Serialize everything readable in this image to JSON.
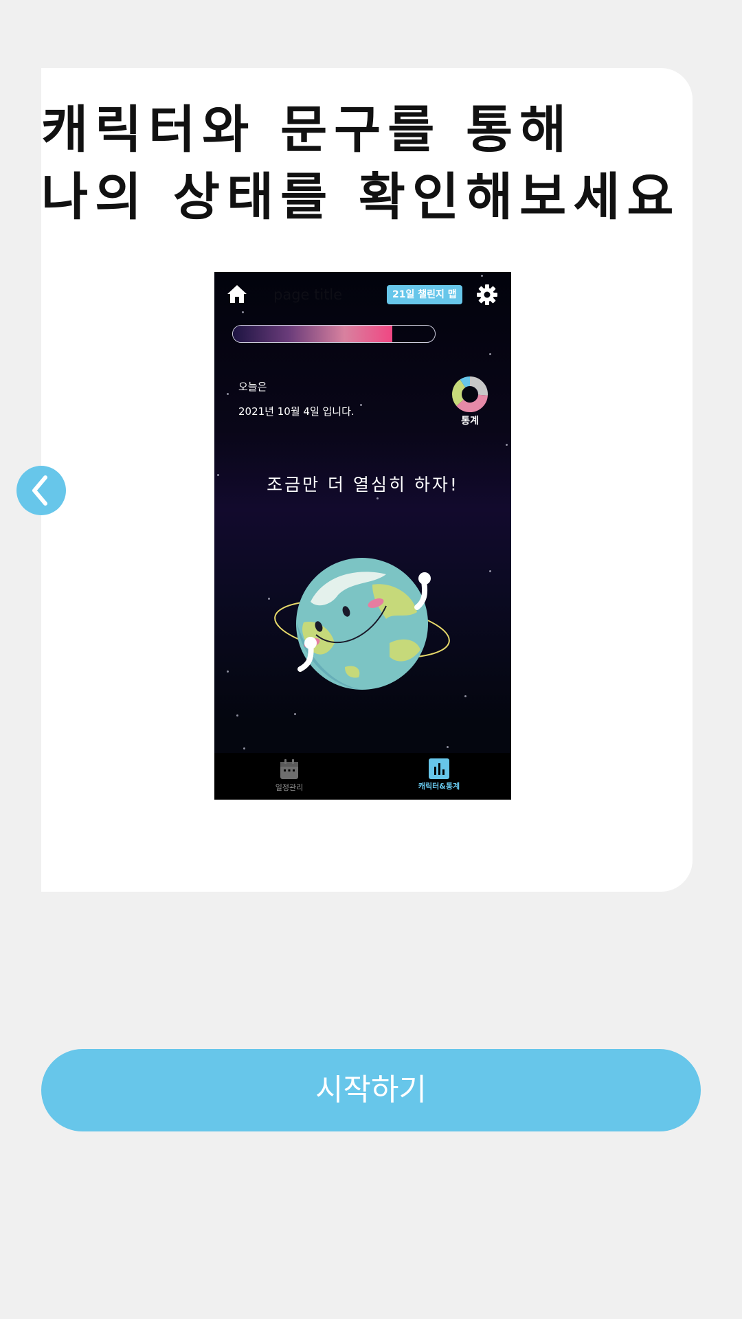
{
  "headline": {
    "line1": "캐릭터와 문구를 통해",
    "line2": "나의 상태를 확인해보세요"
  },
  "back_icon": "chevron-left-icon",
  "preview": {
    "header": {
      "page_title": "page title",
      "challenge_badge": "21일 챌린지 맵",
      "home_icon": "home-icon",
      "settings_icon": "gear-icon"
    },
    "progress": {
      "value": 0.79,
      "fill_color": "#f04783"
    },
    "today_label": "오늘은",
    "today_date": "2021년 10월 4일 입니다.",
    "stats": {
      "label": "통계",
      "icon": "donut-chart-icon"
    },
    "message": "조금만 더 열심히 하자!",
    "character": "earth-character",
    "bottom_nav": [
      {
        "label": "일정관리",
        "icon": "calendar-icon",
        "active": false
      },
      {
        "label": "캐릭터&통계",
        "icon": "bar-chart-icon",
        "active": true
      }
    ]
  },
  "start_button": {
    "label": "시작하기"
  },
  "colors": {
    "accent": "#67c6ea",
    "background": "#f0f0f0",
    "card": "#ffffff",
    "phone_bg": "#04060f",
    "pink": "#f04783"
  }
}
